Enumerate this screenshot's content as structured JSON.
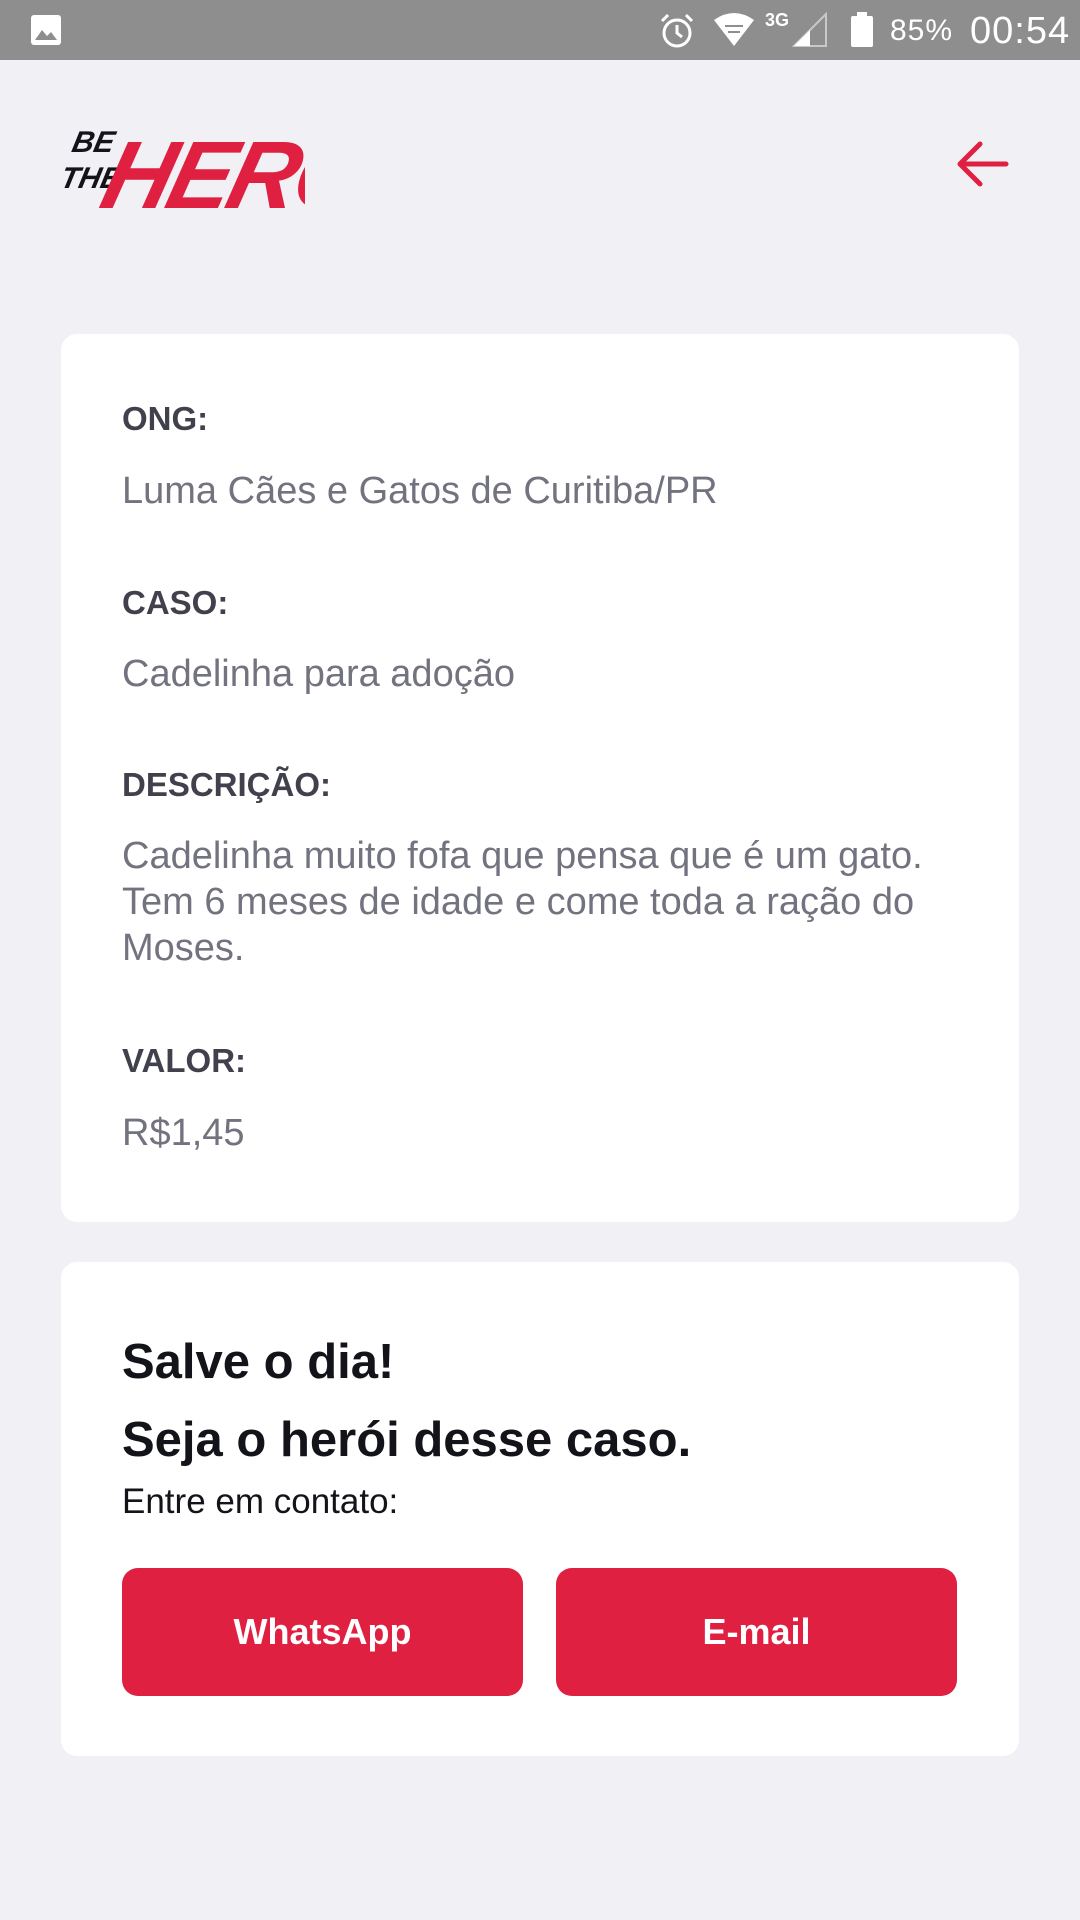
{
  "status_bar": {
    "left_icon": "gallery-icon",
    "icons": [
      "alarm-icon",
      "wifi-icon",
      "signal-icon",
      "battery-icon"
    ],
    "network": "3G",
    "battery": "85%",
    "time": "00:54"
  },
  "header": {
    "logo": {
      "line1": "BE",
      "line2": "THE",
      "word": "HERO"
    },
    "back_icon": "arrow-left-icon"
  },
  "incident": {
    "ong_label": "ONG:",
    "ong_value": "Luma Cães e Gatos de Curitiba/PR",
    "case_label": "CASO:",
    "case_value": "Cadelinha para adoção",
    "description_label": "DESCRIÇÃO:",
    "description_value": "Cadelinha muito fofa que pensa que é um gato. Tem 6 meses de idade e come toda a ração do Moses.",
    "value_label": "VALOR:",
    "value_value": "R$1,45"
  },
  "contact": {
    "title_line1": "Salve o dia!",
    "title_line2": "Seja o herói desse caso.",
    "subtitle": "Entre em contato:",
    "whatsapp_label": "WhatsApp",
    "email_label": "E-mail"
  },
  "colors": {
    "accent": "#e02041",
    "background": "#f0f0f5",
    "status_bar": "#8e8e8e"
  }
}
